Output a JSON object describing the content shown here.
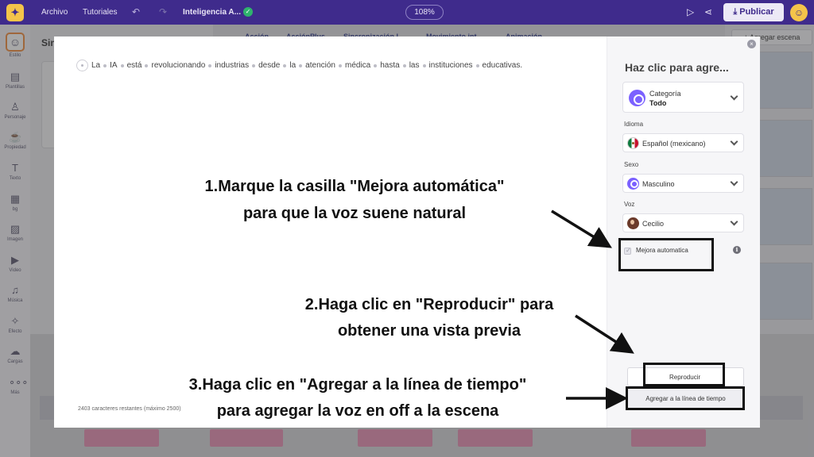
{
  "topbar": {
    "menu_file": "Archivo",
    "menu_tutorials": "Tutoriales",
    "project_name": "Inteligencia A...",
    "zoom": "108%",
    "publish_label": "Publicar"
  },
  "rail": [
    {
      "label": "Estilo",
      "icon": "person-avatar-icon"
    },
    {
      "label": "Plantillas",
      "icon": "template-icon"
    },
    {
      "label": "Personaje",
      "icon": "character-icon"
    },
    {
      "label": "Propiedad",
      "icon": "property-icon"
    },
    {
      "label": "Texto",
      "icon": "text-icon"
    },
    {
      "label": "bg",
      "icon": "background-icon"
    },
    {
      "label": "Imagen",
      "icon": "image-icon"
    },
    {
      "label": "Video",
      "icon": "video-icon"
    },
    {
      "label": "Música",
      "icon": "music-icon"
    },
    {
      "label": "Efecto",
      "icon": "effect-icon"
    },
    {
      "label": "Cargas",
      "icon": "upload-icon"
    },
    {
      "label": "Más",
      "icon": "more-icon"
    }
  ],
  "background": {
    "panel_title": "Sin",
    "tabs": [
      "Acción",
      "AcciónPlus",
      "Sincronización l",
      "Movimiento int",
      "Animación"
    ],
    "add_scene": "+ Agregar escena"
  },
  "modal": {
    "script_words": [
      "La",
      "IA",
      "está",
      "revolucionando",
      "industrias",
      "desde",
      "la",
      "atención",
      "médica",
      "hasta",
      "las",
      "instituciones",
      "educativas."
    ],
    "chars_remaining": "2403 caracteres restantes (máximo 2500)",
    "title": "Haz clic para agre...",
    "category_label": "Categoría",
    "category_value": "Todo",
    "language_label": "Idioma",
    "language_value": "Español (mexicano)",
    "gender_label": "Sexo",
    "gender_value": "Masculino",
    "voice_label": "Voz",
    "voice_value": "Cecilio",
    "auto_enhance_label": "Mejora automatica",
    "auto_enhance_checked": true,
    "play_button": "Reproducir",
    "add_timeline_button": "Agregar a la línea de tiempo"
  },
  "annotations": {
    "step1_line1": "1.Marque la casilla \"Mejora automática\"",
    "step1_line2": "para que la voz suene natural",
    "step2_line1": "2.Haga clic en \"Reproducir\" para",
    "step2_line2": "obtener una vista previa",
    "step3_line1": "3.Haga clic en \"Agregar a la línea de tiempo\"",
    "step3_line2": "para agregar la voz en off a la escena"
  },
  "colors": {
    "topbar": "#3f2b8c",
    "accent": "#7b61ff",
    "highlight_border": "#111111"
  }
}
